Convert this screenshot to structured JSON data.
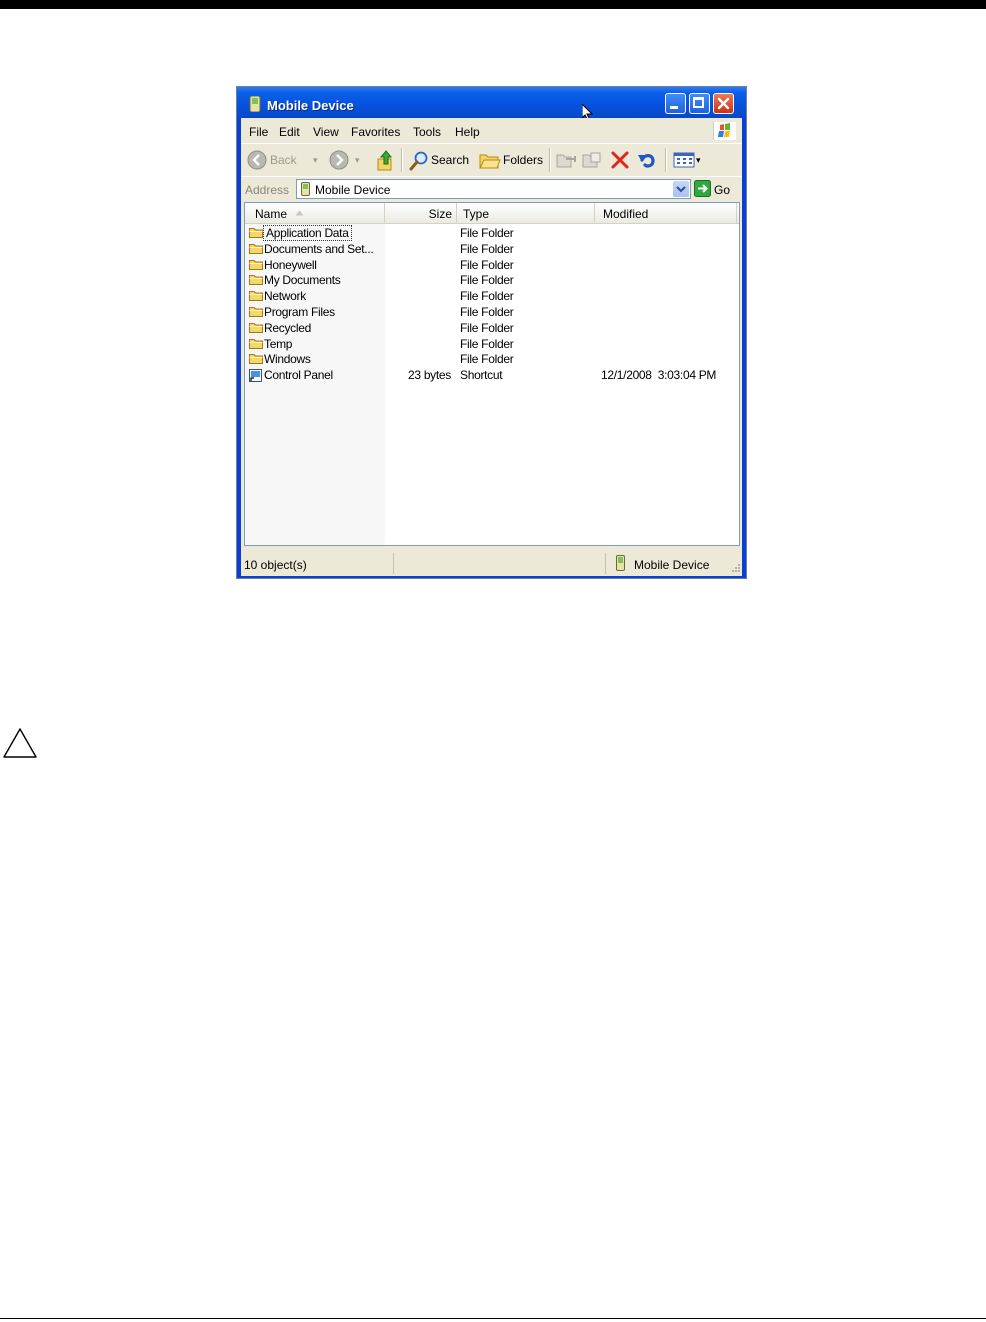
{
  "window": {
    "title": "Mobile Device",
    "title_icon": "mobile-device-icon",
    "controls": [
      "minimize",
      "maximize",
      "close"
    ]
  },
  "menubar": {
    "items": [
      "File",
      "Edit",
      "View",
      "Favorites",
      "Tools",
      "Help"
    ]
  },
  "toolbar": {
    "back_label": "Back",
    "search_label": "Search",
    "folders_label": "Folders",
    "icons": [
      "back-icon",
      "forward-icon",
      "up-folder-icon",
      "search-icon",
      "folders-icon",
      "move-to-icon",
      "copy-to-icon",
      "delete-icon",
      "undo-icon",
      "views-icon"
    ]
  },
  "address": {
    "label": "Address",
    "value": "Mobile Device",
    "go_label": "Go"
  },
  "list": {
    "columns": [
      "Name",
      "Size",
      "Type",
      "Modified"
    ],
    "sort_column": "Name",
    "rows": [
      {
        "name": "Application Data",
        "size": "",
        "type": "File Folder",
        "modified": "",
        "icon": "folder-icon"
      },
      {
        "name": "Documents and Set...",
        "size": "",
        "type": "File Folder",
        "modified": "",
        "icon": "folder-icon"
      },
      {
        "name": "Honeywell",
        "size": "",
        "type": "File Folder",
        "modified": "",
        "icon": "folder-icon"
      },
      {
        "name": "My Documents",
        "size": "",
        "type": "File Folder",
        "modified": "",
        "icon": "folder-icon"
      },
      {
        "name": "Network",
        "size": "",
        "type": "File Folder",
        "modified": "",
        "icon": "folder-icon"
      },
      {
        "name": "Program Files",
        "size": "",
        "type": "File Folder",
        "modified": "",
        "icon": "folder-icon"
      },
      {
        "name": "Recycled",
        "size": "",
        "type": "File Folder",
        "modified": "",
        "icon": "folder-icon"
      },
      {
        "name": "Temp",
        "size": "",
        "type": "File Folder",
        "modified": "",
        "icon": "folder-icon"
      },
      {
        "name": "Windows",
        "size": "",
        "type": "File Folder",
        "modified": "",
        "icon": "folder-icon"
      },
      {
        "name": "Control Panel",
        "size": "23 bytes",
        "type": "Shortcut",
        "modified": "12/1/2008  3:03:04 PM",
        "icon": "shortcut-icon"
      }
    ]
  },
  "statusbar": {
    "objects": "10 object(s)",
    "location": "Mobile Device"
  },
  "colors": {
    "titlebar": "#0552de",
    "chrome": "#ece9d8",
    "close_button": "#c93216"
  }
}
